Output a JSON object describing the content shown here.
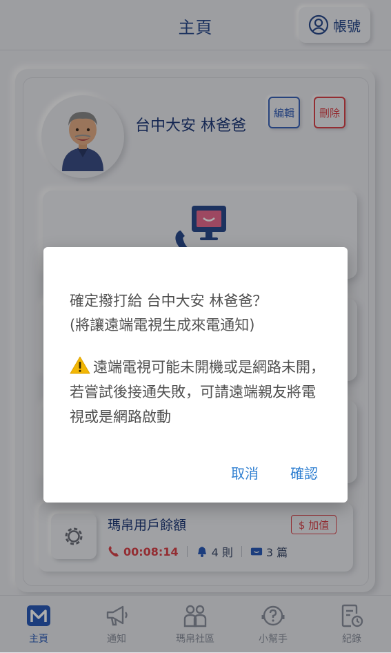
{
  "header": {
    "title": "主頁",
    "account_label": "帳號"
  },
  "member": {
    "name": "台中大安 林爸爸",
    "edit_label": "編輯",
    "delete_label": "刪除"
  },
  "balance": {
    "title": "瑪帛用戶餘額",
    "topup_label": "$ 加值",
    "time": "00:08:14",
    "notices": "4 則",
    "articles": "3 篇"
  },
  "nav": [
    {
      "label": "主頁",
      "icon": "home-m-icon",
      "active": true
    },
    {
      "label": "通知",
      "icon": "megaphone-icon"
    },
    {
      "label": "瑪帛社區",
      "icon": "community-icon"
    },
    {
      "label": "小幫手",
      "icon": "helper-icon"
    },
    {
      "label": "紀錄",
      "icon": "records-icon"
    }
  ],
  "dialog": {
    "line1": "確定撥打給 台中大安 林爸爸？",
    "line2": "(將讓遠端電視生成來電通知)",
    "warning": "遠端電視可能未開機或是網路未開，若嘗試後接通失敗，可請遠端親友將電視或是網路啟動",
    "cancel_label": "取消",
    "confirm_label": "確認"
  },
  "colors": {
    "primary": "#2a5bb8",
    "danger": "#d9434b",
    "dialog_button": "#2f7fd1",
    "warning": "#f2b705"
  }
}
